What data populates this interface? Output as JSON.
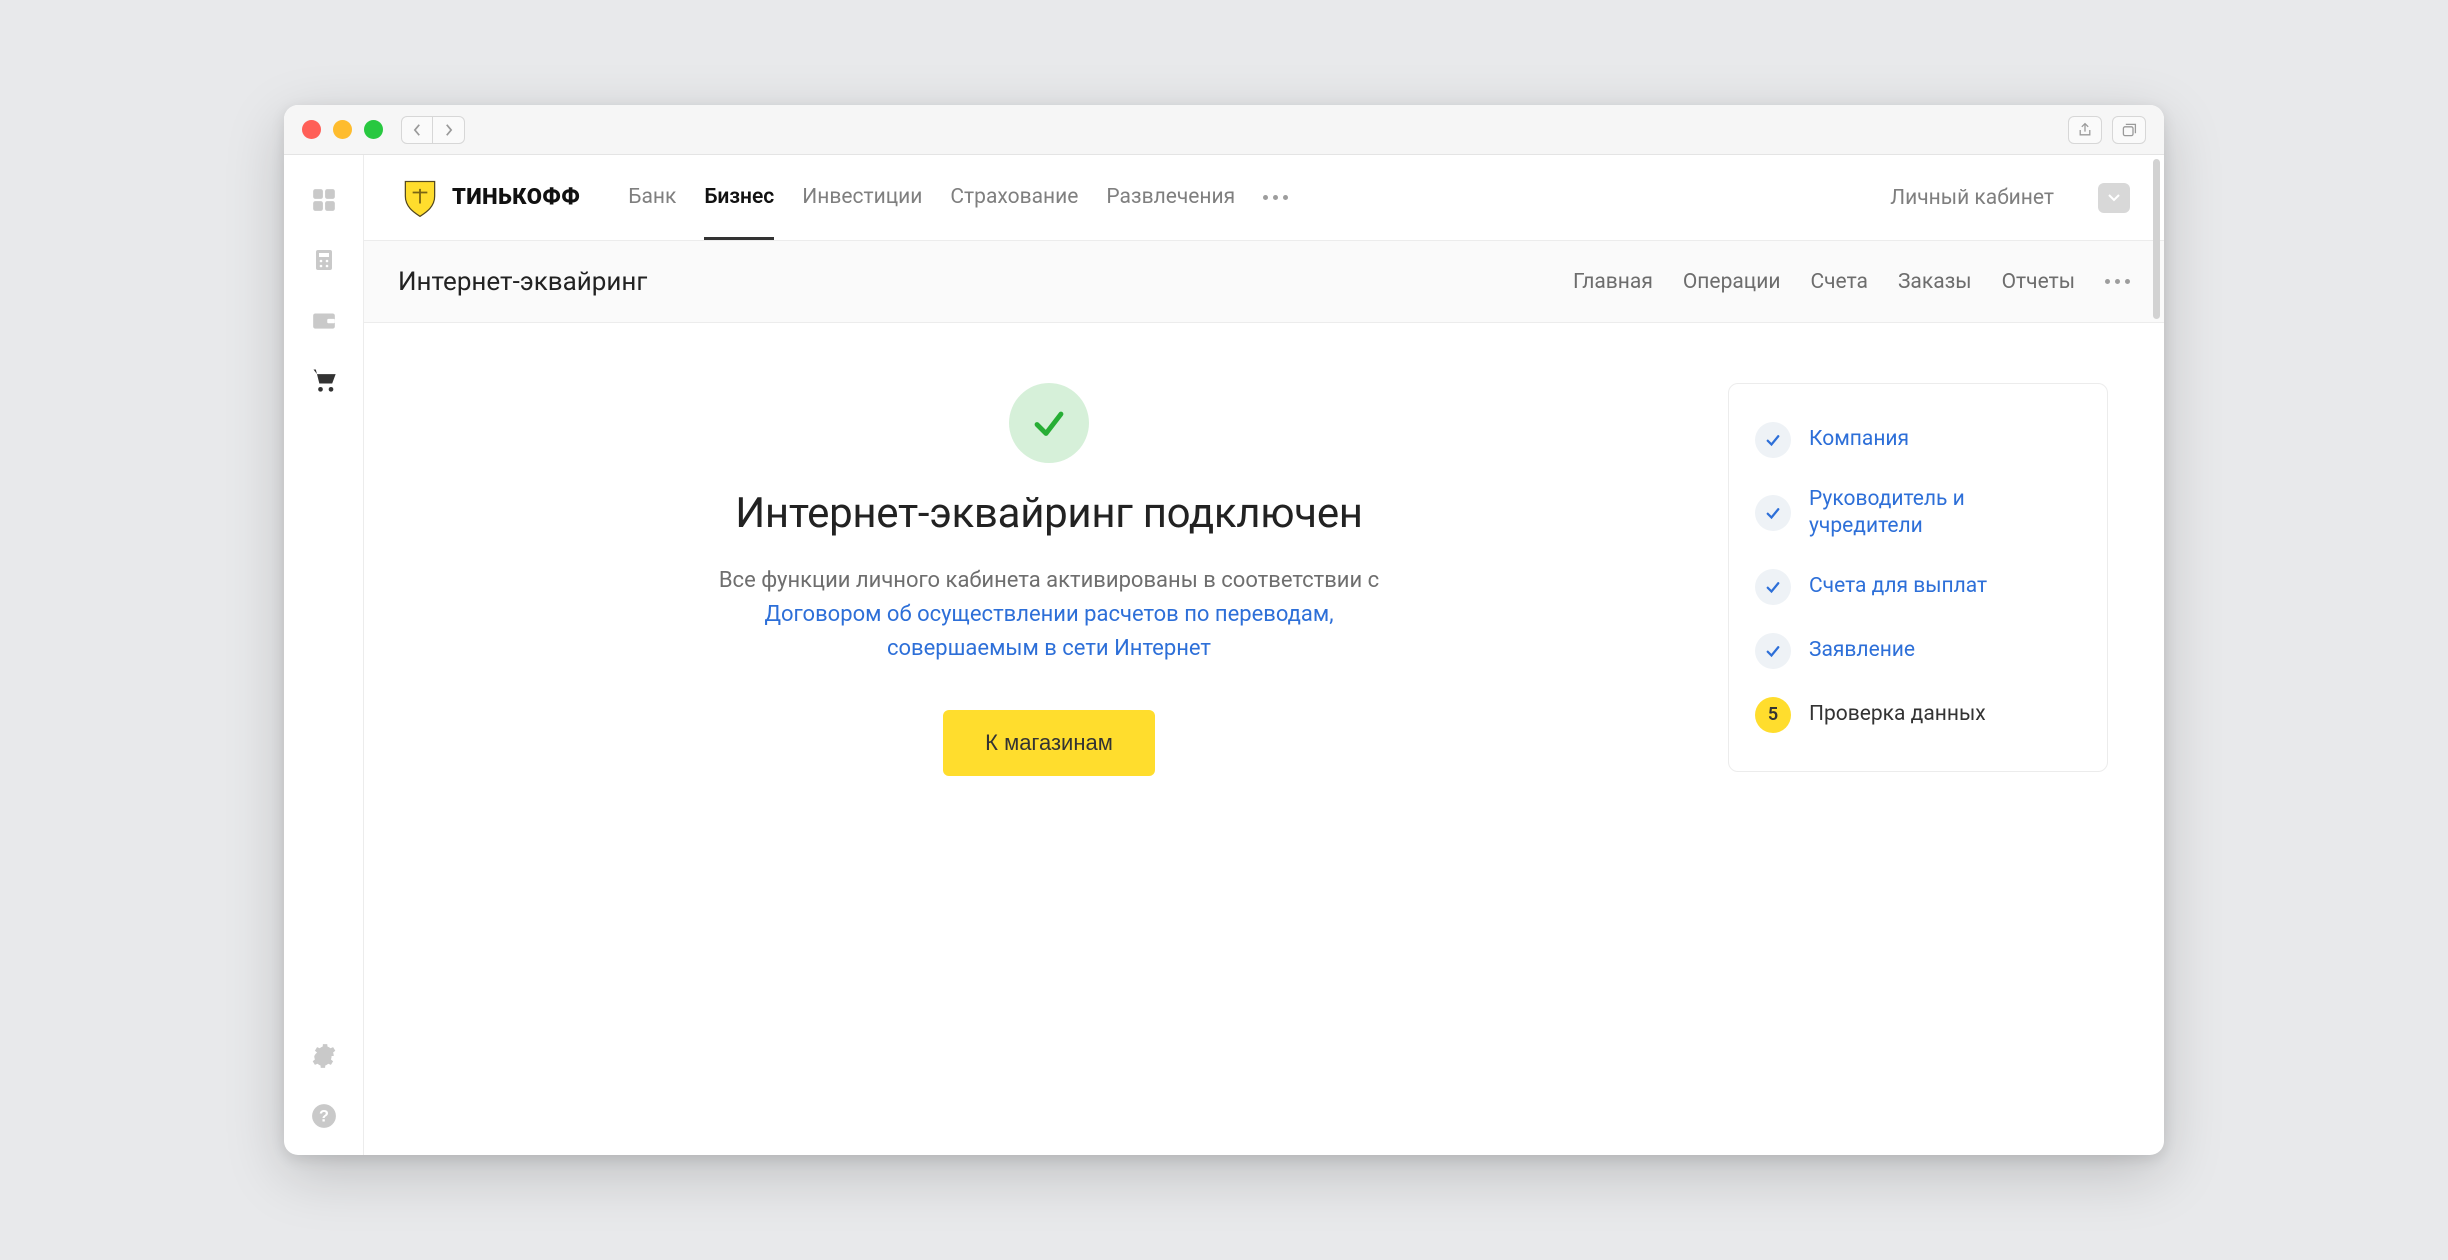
{
  "brand": {
    "name": "ТИНЬКОФФ"
  },
  "topnav": {
    "items": [
      {
        "label": "Банк"
      },
      {
        "label": "Бизнес",
        "active": true
      },
      {
        "label": "Инвестиции"
      },
      {
        "label": "Страхование"
      },
      {
        "label": "Развлечения"
      }
    ],
    "cabinet": "Личный кабинет"
  },
  "secnav": {
    "title": "Интернет-эквайринг",
    "items": [
      {
        "label": "Главная"
      },
      {
        "label": "Операции"
      },
      {
        "label": "Счета"
      },
      {
        "label": "Заказы"
      },
      {
        "label": "Отчеты"
      }
    ]
  },
  "success": {
    "headline": "Интернет-эквайринг подключен",
    "desc_prefix": "Все функции личного кабинета активированы в соответствии с ",
    "desc_link": "Договором об осуществлении расчетов по переводам, совершаемым в сети Интернет",
    "cta": "К магазинам"
  },
  "steps": [
    {
      "label": "Компания",
      "state": "done"
    },
    {
      "label": "Руководитель и учредители",
      "state": "done"
    },
    {
      "label": "Счета для выплат",
      "state": "done"
    },
    {
      "label": "Заявление",
      "state": "done"
    },
    {
      "label": "Проверка данных",
      "state": "current",
      "num": "5"
    }
  ]
}
